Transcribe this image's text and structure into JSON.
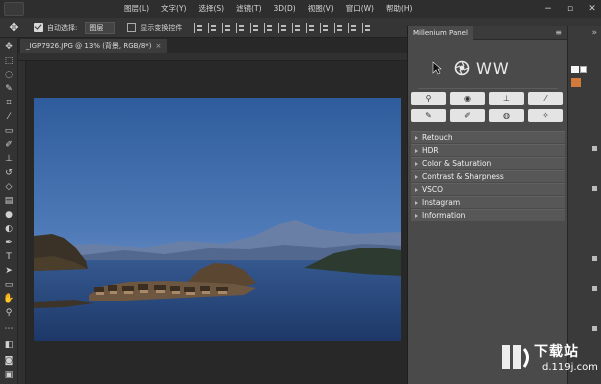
{
  "menubar": {
    "items": [
      "图层(L)",
      "文字(Y)",
      "选择(S)",
      "滤镜(T)",
      "3D(D)",
      "视图(V)",
      "窗口(W)",
      "帮助(H)"
    ]
  },
  "options": {
    "auto_select_label": "自动选择:",
    "auto_select_value": "图层",
    "show_transform_label": "显示变换控件"
  },
  "document": {
    "tab_title": "_IGP7926.JPG @ 13% (背景, RGB/8*)",
    "close_glyph": "×"
  },
  "panel": {
    "title": "Millenium Panel",
    "brand": "WW",
    "sections": [
      "Retouch",
      "HDR",
      "Color & Saturation",
      "Contrast & Sharpness",
      "VSCO",
      "Instagram",
      "Information"
    ]
  },
  "watermark": {
    "text": "下载站",
    "url": "d.119j.com"
  },
  "colors": {
    "foreground_swatch": "#f5f5f5",
    "accent_swatch": "#d37a3a"
  }
}
